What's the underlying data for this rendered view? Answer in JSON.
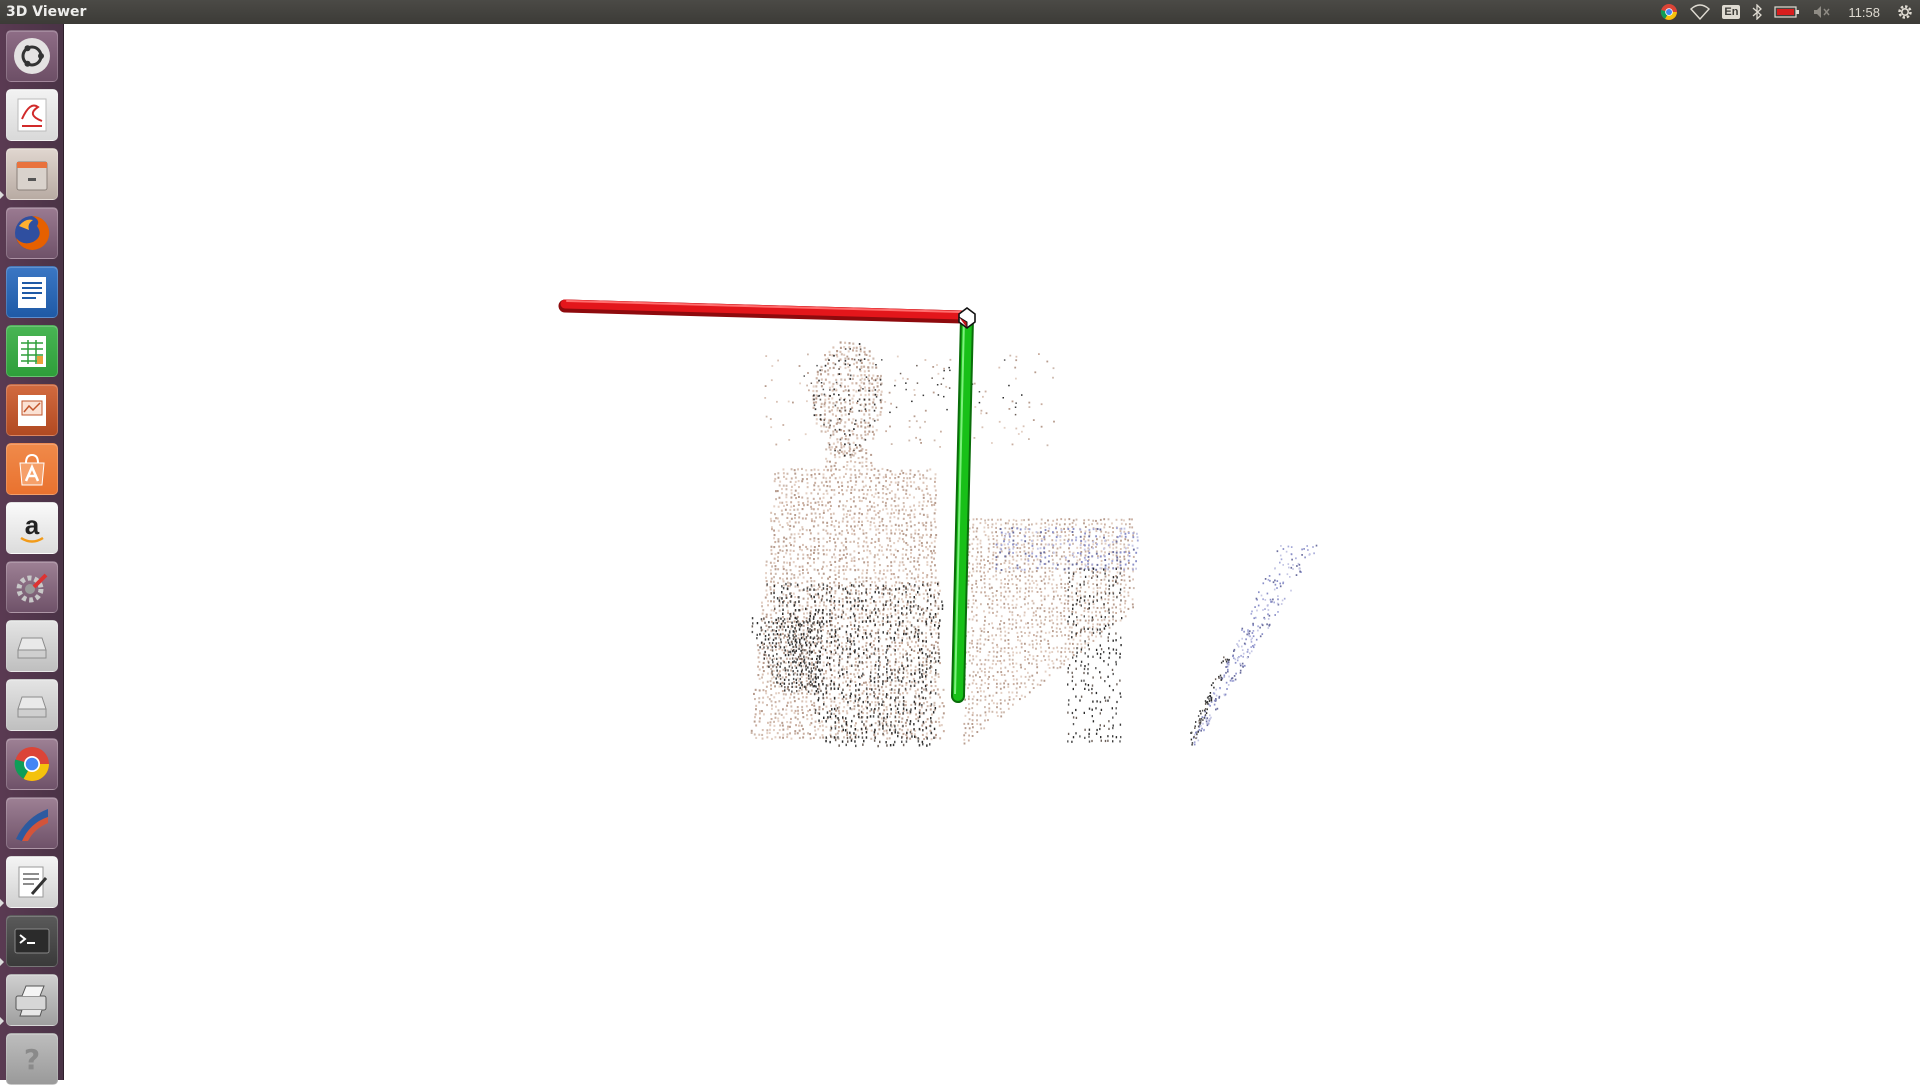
{
  "window": {
    "title": "3D Viewer"
  },
  "panel": {
    "clock": "11:58",
    "keyboard_layout": "En",
    "indicators": [
      "chrome-icon",
      "wifi-icon",
      "keyboard-layout-icon",
      "bluetooth-icon",
      "battery-icon",
      "volume-muted-icon",
      "system-gear-icon"
    ]
  },
  "launcher": {
    "items": [
      {
        "name": "dash-home",
        "icon": "ubuntu-logo-icon",
        "colors": [
          "#e8e8e8",
          "#3c3c3c"
        ]
      },
      {
        "name": "document-viewer",
        "icon": "document-viewer-icon",
        "colors": [
          "#f4f4f4",
          "#d12a2a"
        ]
      },
      {
        "name": "files",
        "icon": "file-cabinet-icon",
        "colors": [
          "#c9c0b7",
          "#e9723d"
        ]
      },
      {
        "name": "firefox",
        "icon": "firefox-icon",
        "colors": [
          "#e66000",
          "#2f4fa0"
        ]
      },
      {
        "name": "writer",
        "icon": "libreoffice-writer-icon",
        "colors": [
          "#1f5aa6",
          "#ffffff"
        ]
      },
      {
        "name": "calc",
        "icon": "libreoffice-calc-icon",
        "colors": [
          "#2e9e3a",
          "#ffffff"
        ]
      },
      {
        "name": "impress",
        "icon": "libreoffice-impress-icon",
        "colors": [
          "#c2552b",
          "#ffffff"
        ]
      },
      {
        "name": "software-center",
        "icon": "software-center-icon",
        "colors": [
          "#e9722f",
          "#ffffff"
        ]
      },
      {
        "name": "amazon",
        "icon": "amazon-icon",
        "colors": [
          "#f0f0f0",
          "#222222"
        ]
      },
      {
        "name": "system-settings",
        "icon": "system-settings-icon",
        "colors": [
          "#8a8a8a",
          "#d33"
        ]
      },
      {
        "name": "drive-1",
        "icon": "disk-drive-icon",
        "colors": [
          "#cfcfcf",
          "#8c8c8c"
        ]
      },
      {
        "name": "drive-2",
        "icon": "disk-drive-icon",
        "colors": [
          "#cfcfcf",
          "#8c8c8c"
        ]
      },
      {
        "name": "chrome",
        "icon": "chrome-icon",
        "colors": [
          "#db4437",
          "#4285f4"
        ]
      },
      {
        "name": "color-app",
        "icon": "color-fan-icon",
        "colors": [
          "#2c5aa0",
          "#d3543a"
        ]
      },
      {
        "name": "text-editor",
        "icon": "text-editor-icon",
        "colors": [
          "#f0f0f0",
          "#333333"
        ]
      },
      {
        "name": "terminal",
        "icon": "terminal-icon",
        "colors": [
          "#2b2b2b",
          "#ffffff"
        ]
      },
      {
        "name": "printer-tool",
        "icon": "printer-icon",
        "colors": [
          "#bfbfbf",
          "#555555"
        ]
      },
      {
        "name": "help",
        "icon": "help-icon",
        "colors": [
          "#bdbdbd",
          "#8a8a8a"
        ]
      }
    ]
  },
  "scene": {
    "axes": [
      {
        "name": "x-axis",
        "color": "#e3161b"
      },
      {
        "name": "y-axis",
        "color": "#18c018"
      }
    ],
    "point_cloud_colors": [
      "#d9c2b5",
      "#3a3a3a",
      "#8a8fc8"
    ]
  }
}
